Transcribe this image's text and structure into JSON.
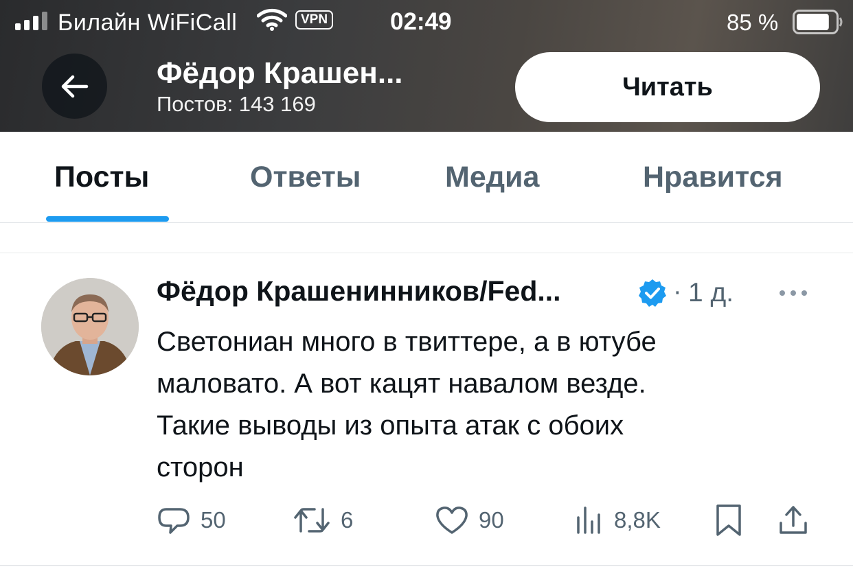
{
  "status_bar": {
    "carrier": "Билайн WiFiCall",
    "vpn": "VPN",
    "time": "02:49",
    "battery": "85 %",
    "battery_level": 0.85,
    "icons": [
      "cellular-signal-icon",
      "wifi-icon",
      "battery-icon"
    ]
  },
  "header": {
    "back_icon": "arrow-left-icon",
    "name": "Фёдор Крашен...",
    "posts_count": "Постов: 143 169",
    "follow_label": "Читать"
  },
  "tabs": [
    {
      "label": "Посты",
      "active": true
    },
    {
      "label": "Ответы",
      "active": false
    },
    {
      "label": "Медиа",
      "active": false
    },
    {
      "label": "Нравится",
      "active": false
    }
  ],
  "tweet": {
    "author": "Фёдор Крашенинников/Fed...",
    "verified": true,
    "separator": "·",
    "time": "1 д.",
    "text": "Светониан много в твиттере, а в ютубе\nмаловато. А вот кацят навалом везде.\nТакие выводы из опыта атак с обоих\nсторон",
    "actions": {
      "replies": "50",
      "retweets": "6",
      "likes": "90",
      "views": "8,8K"
    }
  },
  "colors": {
    "accent": "#1d9bf0",
    "text_primary": "#0f1419",
    "text_secondary": "#536471",
    "divider": "#e7e9eb"
  }
}
